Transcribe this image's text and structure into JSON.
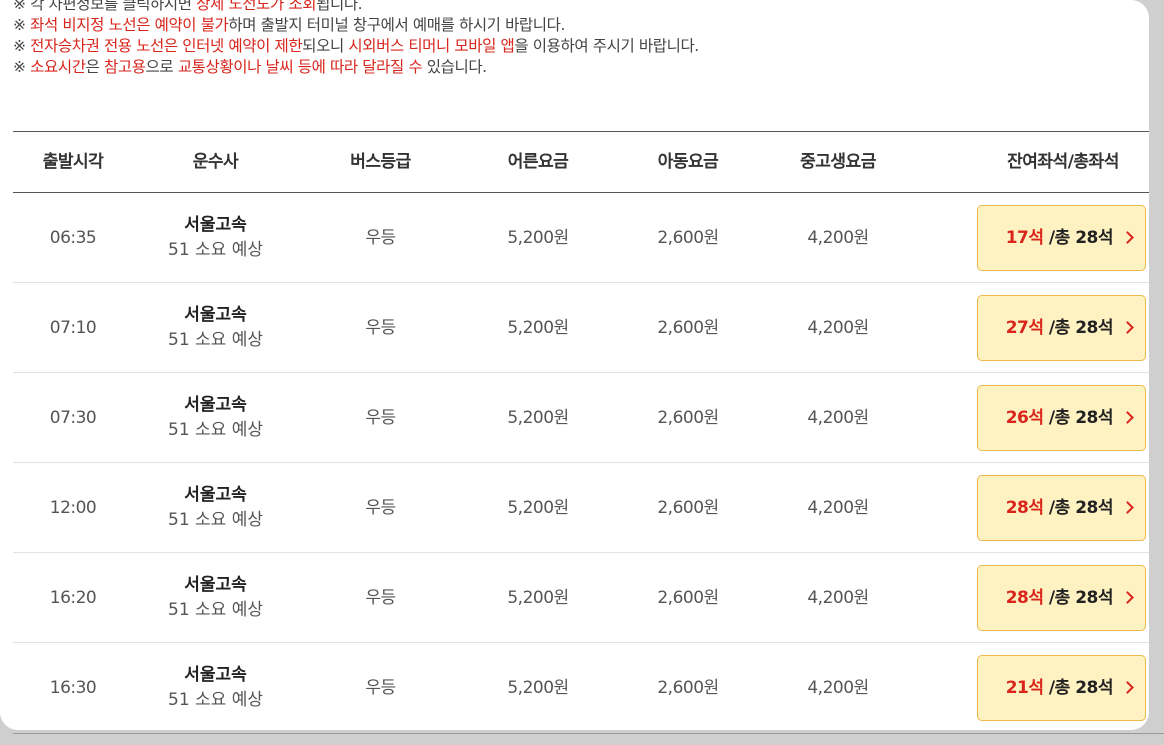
{
  "notices": [
    {
      "parts": [
        {
          "t": "※ 각 차편정보를 클릭하시면 ",
          "red": false
        },
        {
          "t": "상세 노선도가 조회",
          "red": true
        },
        {
          "t": "됩니다.",
          "red": false
        }
      ]
    },
    {
      "parts": [
        {
          "t": "※ ",
          "red": false
        },
        {
          "t": "좌석 비지정 노선은 예약이 불가",
          "red": true
        },
        {
          "t": "하며 출발지 터미널 창구에서 예매를 하시기 바랍니다.",
          "red": false
        }
      ]
    },
    {
      "parts": [
        {
          "t": "※ ",
          "red": false
        },
        {
          "t": "전자승차권 전용 노선은 인터넷 예약이 제한",
          "red": true
        },
        {
          "t": "되오니 ",
          "red": false
        },
        {
          "t": "시외버스 티머니 모바일 앱",
          "red": true
        },
        {
          "t": "을 이용하여 주시기 바랍니다.",
          "red": false
        }
      ]
    },
    {
      "parts": [
        {
          "t": "※ ",
          "red": false
        },
        {
          "t": "소요시간",
          "red": true
        },
        {
          "t": "은 ",
          "red": false
        },
        {
          "t": "참고용",
          "red": true
        },
        {
          "t": "으로 ",
          "red": false
        },
        {
          "t": "교통상황이나 날씨 등에 따라 달라질 수",
          "red": true
        },
        {
          "t": " 있습니다.",
          "red": false
        }
      ]
    }
  ],
  "columns": {
    "time": "출발시각",
    "company": "운수사",
    "grade": "버스등급",
    "adult": "어른요금",
    "child": "아동요금",
    "teen": "중고생요금",
    "seats": "잔여좌석/총좌석"
  },
  "rows": [
    {
      "time": "06:35",
      "company": "서울고속",
      "duration": "51 소요 예상",
      "grade": "우등",
      "adult": "5,200원",
      "child": "2,600원",
      "teen": "4,200원",
      "remain": "17석",
      "total": " /총 28석"
    },
    {
      "time": "07:10",
      "company": "서울고속",
      "duration": "51 소요 예상",
      "grade": "우등",
      "adult": "5,200원",
      "child": "2,600원",
      "teen": "4,200원",
      "remain": "27석",
      "total": " /총 28석"
    },
    {
      "time": "07:30",
      "company": "서울고속",
      "duration": "51 소요 예상",
      "grade": "우등",
      "adult": "5,200원",
      "child": "2,600원",
      "teen": "4,200원",
      "remain": "26석",
      "total": " /총 28석"
    },
    {
      "time": "12:00",
      "company": "서울고속",
      "duration": "51 소요 예상",
      "grade": "우등",
      "adult": "5,200원",
      "child": "2,600원",
      "teen": "4,200원",
      "remain": "28석",
      "total": " /총 28석"
    },
    {
      "time": "16:20",
      "company": "서울고속",
      "duration": "51 소요 예상",
      "grade": "우등",
      "adult": "5,200원",
      "child": "2,600원",
      "teen": "4,200원",
      "remain": "28석",
      "total": " /총 28석"
    },
    {
      "time": "16:30",
      "company": "서울고속",
      "duration": "51 소요 예상",
      "grade": "우등",
      "adult": "5,200원",
      "child": "2,600원",
      "teen": "4,200원",
      "remain": "21석",
      "total": " /총 28석"
    }
  ],
  "colors": {
    "accent_red": "#d9251c",
    "seat_button_bg": "#fff2c2",
    "seat_button_border": "#f0b84a"
  },
  "icons": {
    "seat_chevron": "chevron-right-icon"
  }
}
